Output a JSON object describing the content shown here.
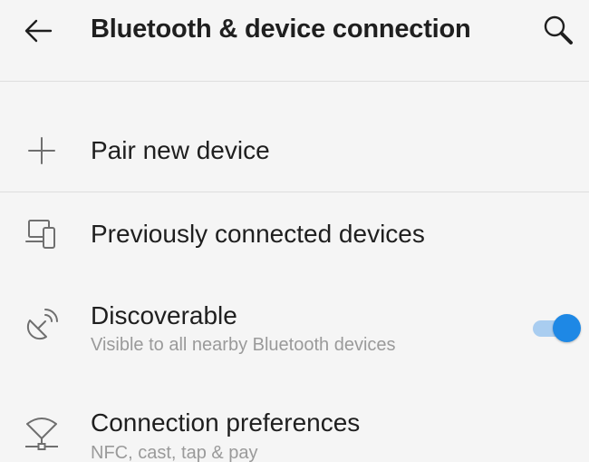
{
  "header": {
    "title": "Bluetooth & device connection",
    "back_icon": "arrow-left-icon",
    "search_icon": "search-icon"
  },
  "items": [
    {
      "label": "Pair new device",
      "icon": "plus-icon"
    },
    {
      "label": "Previously connected devices",
      "icon": "devices-icon"
    },
    {
      "label": "Discoverable",
      "sublabel": "Visible to all nearby Bluetooth devices",
      "icon": "satellite-dish-icon",
      "toggle_on": true
    },
    {
      "label": "Connection preferences",
      "sublabel": "NFC, cast, tap & pay",
      "icon": "connection-icon"
    }
  ],
  "colors": {
    "background": "#f5f5f5",
    "accent": "#1e88e5",
    "toggle_track": "#a9cdf0",
    "divider": "#dedede",
    "secondary_text": "#9a9a9a"
  }
}
